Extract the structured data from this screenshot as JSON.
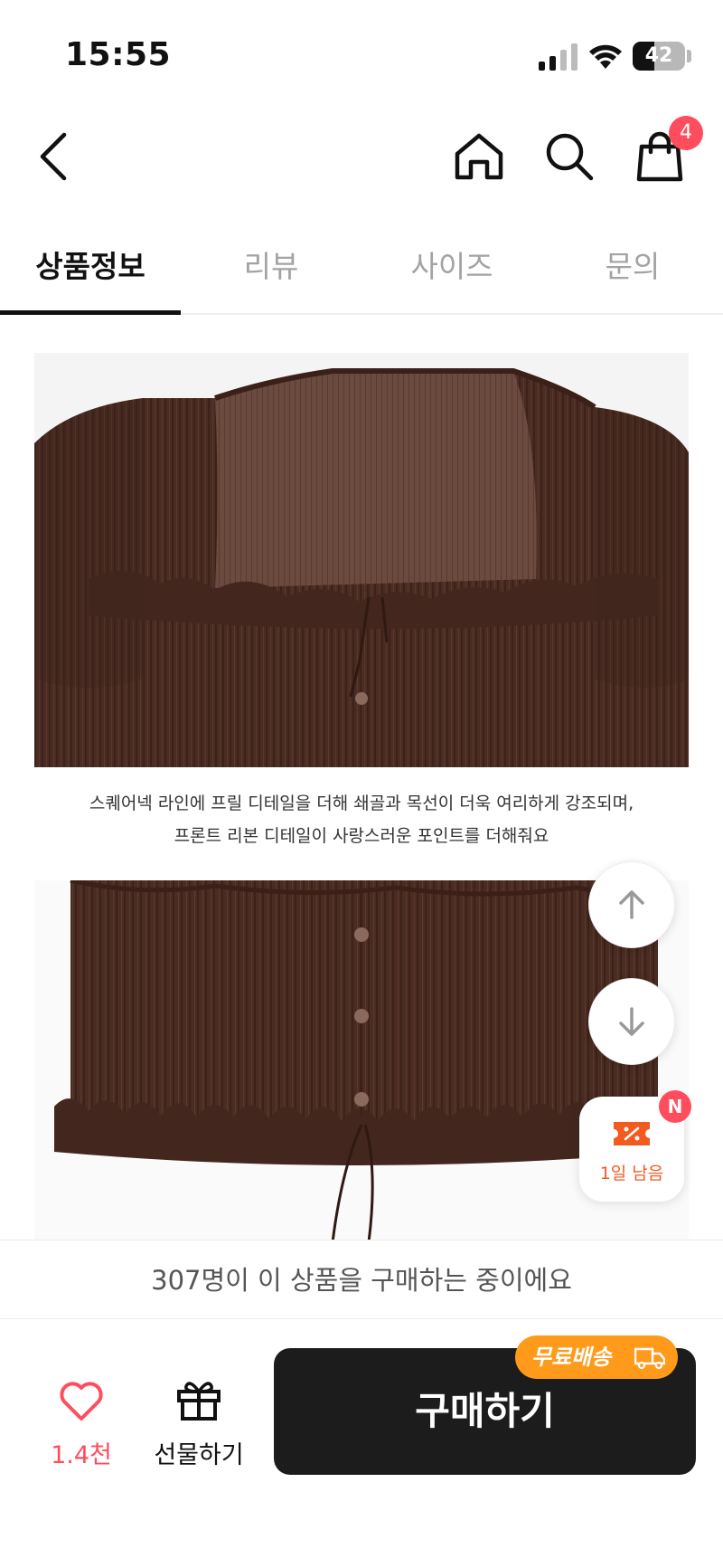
{
  "status": {
    "time": "15:55",
    "battery": "42",
    "battery_level": 0.42
  },
  "header": {
    "cart_count": "4"
  },
  "tabs": [
    {
      "label": "상품정보",
      "active": true
    },
    {
      "label": "리뷰",
      "active": false
    },
    {
      "label": "사이즈",
      "active": false
    },
    {
      "label": "문의",
      "active": false
    }
  ],
  "product": {
    "caption_line1": "스퀘어넥 라인에 프릴 디테일을 더해 쇄골과 목선이 더욱 여리하게 강조되며,",
    "caption_line2": "프론트 리본 디테일이 사랑스러운 포인트를 더해줘요",
    "garment_color": "#4a2c22"
  },
  "floating": {
    "coupon_label": "1일 남음",
    "coupon_badge": "N"
  },
  "buying_banner": "307명이 이 상품을 구매하는 중이에요",
  "bottom_bar": {
    "like_count": "1.4천",
    "gift_label": "선물하기",
    "buy_label": "구매하기",
    "free_shipping": "무료배송"
  },
  "colors": {
    "accent_red": "#ff4d5e",
    "free_ship_orange": "#ff9a1a",
    "coupon_orange": "#f25a1f",
    "buy_button": "#1c1c1c"
  }
}
